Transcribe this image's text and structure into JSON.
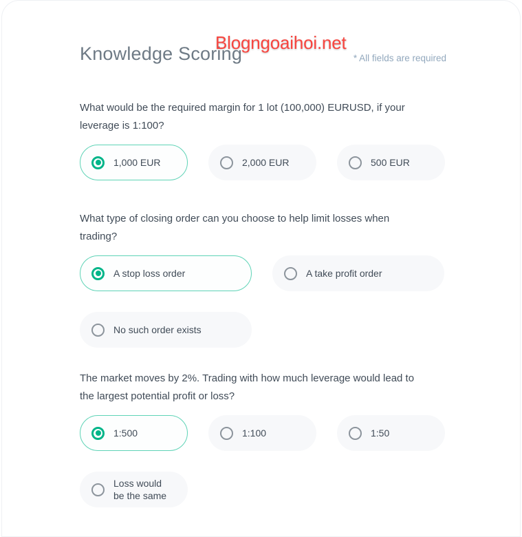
{
  "header": {
    "title": "Knowledge Scoring",
    "required_note": "* All fields are required"
  },
  "watermark": {
    "text": "Blogngoaihoi.net",
    "color": "#f8453f"
  },
  "theme": {
    "accent": "#00b589",
    "selected_border": "#5ed3b6",
    "pill_bg": "#f7f8fa",
    "radio_ring": "#8c949c",
    "question_text": "#404b57",
    "title_text": "#6e7a85",
    "note_text": "#92a8bd"
  },
  "questions": [
    {
      "text": "What would be the required margin for 1 lot (100,000) EURUSD, if your leverage is 1:100?",
      "options": [
        {
          "label": "1,000 EUR",
          "selected": true
        },
        {
          "label": "2,000 EUR",
          "selected": false
        },
        {
          "label": "500 EUR",
          "selected": false
        }
      ]
    },
    {
      "text": "What type of closing order can you choose to help limit losses when trading?",
      "options": [
        {
          "label": "A stop loss order",
          "selected": true
        },
        {
          "label": "A take profit order",
          "selected": false
        },
        {
          "label": "No such order exists",
          "selected": false
        }
      ]
    },
    {
      "text": "The market moves by 2%. Trading with how much leverage would lead to the largest potential profit or loss?",
      "options": [
        {
          "label": "1:500",
          "selected": true
        },
        {
          "label": "1:100",
          "selected": false
        },
        {
          "label": "1:50",
          "selected": false
        },
        {
          "label": "Loss would be the same",
          "selected": false
        }
      ]
    }
  ]
}
